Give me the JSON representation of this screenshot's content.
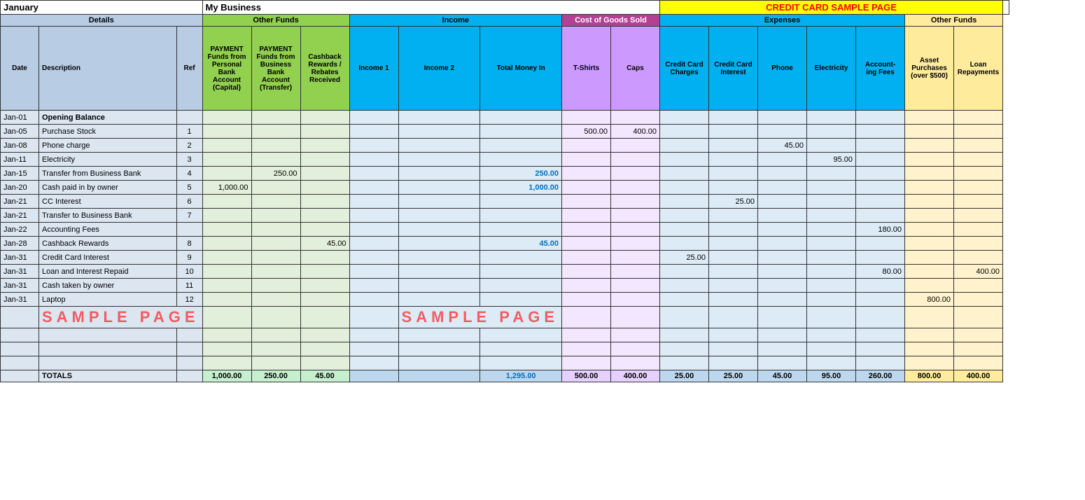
{
  "title": {
    "month": "January",
    "business": "My Business",
    "credit_card_title": "CREDIT CARD SAMPLE PAGE"
  },
  "section_labels": {
    "details": "Details",
    "other_funds": "Other Funds",
    "income": "Income",
    "cogs": "Cost of Goods Sold",
    "expenses": "Expenses",
    "other_funds2": "Other Funds"
  },
  "column_headers": {
    "date": "Date",
    "description": "Description",
    "ref": "Ref",
    "payment_personal": "PAYMENT Funds from Personal Bank Account (Capital)",
    "payment_business": "PAYMENT Funds from Business Bank Account (Transfer)",
    "cashback": "Cashback Rewards / Rebates Received",
    "income1": "Income 1",
    "income2": "Income 2",
    "total_money": "Total Money In",
    "tshirts": "T-Shirts",
    "caps": "Caps",
    "cc_charges": "Credit Card Charges",
    "cc_interest": "Credit Card Interest",
    "phone": "Phone",
    "electricity": "Electricity",
    "accounting_fees": "Account- ing Fees",
    "asset_purchases": "Asset Purchases (over $500)",
    "loan_repayments": "Loan Repayments"
  },
  "rows": [
    {
      "date": "Jan-01",
      "desc": "Opening Balance",
      "ref": "",
      "of1": "",
      "of2": "",
      "cash": "",
      "inc1": "",
      "inc2": "",
      "total": "",
      "tsh": "",
      "caps": "",
      "ccc": "",
      "cci": "",
      "phone": "",
      "elec": "",
      "acct": "",
      "asset": "",
      "loan": "",
      "bold_desc": true
    },
    {
      "date": "Jan-05",
      "desc": "Purchase Stock",
      "ref": "1",
      "of1": "",
      "of2": "",
      "cash": "",
      "inc1": "",
      "inc2": "",
      "total": "",
      "tsh": "500.00",
      "caps": "400.00",
      "ccc": "",
      "cci": "",
      "phone": "",
      "elec": "",
      "acct": "",
      "asset": "",
      "loan": ""
    },
    {
      "date": "Jan-08",
      "desc": "Phone charge",
      "ref": "2",
      "of1": "",
      "of2": "",
      "cash": "",
      "inc1": "",
      "inc2": "",
      "total": "",
      "tsh": "",
      "caps": "",
      "ccc": "",
      "cci": "",
      "phone": "45.00",
      "elec": "",
      "acct": "",
      "asset": "",
      "loan": ""
    },
    {
      "date": "Jan-11",
      "desc": "Electricity",
      "ref": "3",
      "of1": "",
      "of2": "",
      "cash": "",
      "inc1": "",
      "inc2": "",
      "total": "",
      "tsh": "",
      "caps": "",
      "ccc": "",
      "cci": "",
      "phone": "",
      "elec": "95.00",
      "acct": "",
      "asset": "",
      "loan": ""
    },
    {
      "date": "Jan-15",
      "desc": "Transfer from Business Bank",
      "ref": "4",
      "of1": "",
      "of2": "250.00",
      "cash": "",
      "inc1": "",
      "inc2": "",
      "total": "250.00",
      "tsh": "",
      "caps": "",
      "ccc": "",
      "cci": "",
      "phone": "",
      "elec": "",
      "acct": "",
      "asset": "",
      "loan": "",
      "bold_total": true
    },
    {
      "date": "Jan-20",
      "desc": "Cash paid in by owner",
      "ref": "5",
      "of1": "1,000.00",
      "of2": "",
      "cash": "",
      "inc1": "",
      "inc2": "",
      "total": "1,000.00",
      "tsh": "",
      "caps": "",
      "ccc": "",
      "cci": "",
      "phone": "",
      "elec": "",
      "acct": "",
      "asset": "",
      "loan": "",
      "bold_total": true
    },
    {
      "date": "Jan-21",
      "desc": "CC Interest",
      "ref": "6",
      "of1": "",
      "of2": "",
      "cash": "",
      "inc1": "",
      "inc2": "",
      "total": "",
      "tsh": "",
      "caps": "",
      "ccc": "",
      "cci": "25.00",
      "phone": "",
      "elec": "",
      "acct": "",
      "asset": "",
      "loan": ""
    },
    {
      "date": "Jan-21",
      "desc": "Transfer to Business Bank",
      "ref": "7",
      "of1": "",
      "of2": "",
      "cash": "",
      "inc1": "",
      "inc2": "",
      "total": "",
      "tsh": "",
      "caps": "",
      "ccc": "",
      "cci": "",
      "phone": "",
      "elec": "",
      "acct": "",
      "asset": "",
      "loan": ""
    },
    {
      "date": "Jan-22",
      "desc": "Accounting Fees",
      "ref": "",
      "of1": "",
      "of2": "",
      "cash": "",
      "inc1": "",
      "inc2": "",
      "total": "",
      "tsh": "",
      "caps": "",
      "ccc": "",
      "cci": "",
      "phone": "",
      "elec": "",
      "acct": "180.00",
      "asset": "",
      "loan": ""
    },
    {
      "date": "Jan-28",
      "desc": "Cashback Rewards",
      "ref": "8",
      "of1": "",
      "of2": "",
      "cash": "45.00",
      "inc1": "",
      "inc2": "",
      "total": "45.00",
      "tsh": "",
      "caps": "",
      "ccc": "",
      "cci": "",
      "phone": "",
      "elec": "",
      "acct": "",
      "asset": "",
      "loan": "",
      "bold_total": true
    },
    {
      "date": "Jan-31",
      "desc": "Credit Card Interest",
      "ref": "9",
      "of1": "",
      "of2": "",
      "cash": "",
      "inc1": "",
      "inc2": "",
      "total": "",
      "tsh": "",
      "caps": "",
      "ccc": "25.00",
      "cci": "",
      "phone": "",
      "elec": "",
      "acct": "",
      "asset": "",
      "loan": ""
    },
    {
      "date": "Jan-31",
      "desc": "Loan and Interest Repaid",
      "ref": "10",
      "of1": "",
      "of2": "",
      "cash": "",
      "inc1": "",
      "inc2": "",
      "total": "",
      "tsh": "",
      "caps": "",
      "ccc": "",
      "cci": "",
      "phone": "",
      "elec": "",
      "acct": "80.00",
      "asset": "",
      "loan": "400.00"
    },
    {
      "date": "Jan-31",
      "desc": "Cash taken by owner",
      "ref": "11",
      "of1": "",
      "of2": "",
      "cash": "",
      "inc1": "",
      "inc2": "",
      "total": "",
      "tsh": "",
      "caps": "",
      "ccc": "",
      "cci": "",
      "phone": "",
      "elec": "",
      "acct": "",
      "asset": "",
      "loan": ""
    },
    {
      "date": "Jan-31",
      "desc": "Laptop",
      "ref": "12",
      "of1": "",
      "of2": "",
      "cash": "",
      "inc1": "",
      "inc2": "",
      "total": "",
      "tsh": "",
      "caps": "",
      "ccc": "",
      "cci": "",
      "phone": "",
      "elec": "",
      "acct": "",
      "asset": "800.00",
      "loan": ""
    },
    {
      "date": "",
      "desc": "",
      "ref": "",
      "of1": "",
      "of2": "",
      "cash": "",
      "inc1": "",
      "inc2": "",
      "total": "",
      "tsh": "",
      "caps": "",
      "ccc": "",
      "cci": "",
      "phone": "",
      "elec": "",
      "acct": "",
      "asset": "",
      "loan": "",
      "sample": true
    },
    {
      "date": "",
      "desc": "",
      "ref": "",
      "of1": "",
      "of2": "",
      "cash": "",
      "inc1": "",
      "inc2": "",
      "total": "",
      "tsh": "",
      "caps": "",
      "ccc": "",
      "cci": "",
      "phone": "",
      "elec": "",
      "acct": "",
      "asset": "",
      "loan": ""
    },
    {
      "date": "",
      "desc": "",
      "ref": "",
      "of1": "",
      "of2": "",
      "cash": "",
      "inc1": "",
      "inc2": "",
      "total": "",
      "tsh": "",
      "caps": "",
      "ccc": "",
      "cci": "",
      "phone": "",
      "elec": "",
      "acct": "",
      "asset": "",
      "loan": ""
    },
    {
      "date": "",
      "desc": "",
      "ref": "",
      "of1": "",
      "of2": "",
      "cash": "",
      "inc1": "",
      "inc2": "",
      "total": "",
      "tsh": "",
      "caps": "",
      "ccc": "",
      "cci": "",
      "phone": "",
      "elec": "",
      "acct": "",
      "asset": "",
      "loan": ""
    }
  ],
  "totals": {
    "label": "TOTALS",
    "of1": "1,000.00",
    "of2": "250.00",
    "cash": "45.00",
    "inc1": "",
    "inc2": "",
    "total": "1,295.00",
    "tsh": "500.00",
    "caps": "400.00",
    "ccc": "25.00",
    "cci": "25.00",
    "phone": "45.00",
    "elec": "95.00",
    "acct": "260.00",
    "asset": "800.00",
    "loan": "400.00"
  },
  "sample_text": "SAMPLE PAGE"
}
